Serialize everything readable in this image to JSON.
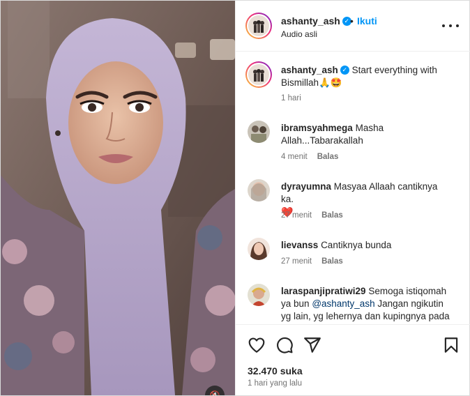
{
  "header": {
    "username": "ashanty_ash",
    "separator": "•",
    "follow_label": "Ikuti",
    "audio_label": "Audio asli",
    "verified_icon": "verified-badge-icon",
    "more_icon": "more-options-icon"
  },
  "caption": {
    "username": "ashanty_ash",
    "text": "Start everything with Bismillah",
    "emoji": "🙏🤩",
    "time": "1 hari"
  },
  "comments": [
    {
      "username": "ibramsyahmega",
      "text": "Masha Allah...Tabarakallah",
      "time": "4 menit",
      "reply_label": "Balas"
    },
    {
      "username": "dyrayumna",
      "text": "Masyaa Allaah cantiknya ka.",
      "emoji": "❤️",
      "time": "27 menit",
      "reply_label": "Balas"
    },
    {
      "username": "lievanss",
      "text": "Cantiknya bunda",
      "time": "27 menit",
      "reply_label": "Balas"
    },
    {
      "username": "laraspanjipratiwi29",
      "text_before": "Semoga istiqomah ya bun",
      "mention": "@ashanty_ash",
      "text_after": "Jangan ngikutin yg lain, yg lehernya dan kupingnya pada"
    }
  ],
  "actions": {
    "icons": [
      "heart-icon",
      "comment-icon",
      "share-icon",
      "bookmark-icon"
    ],
    "likes": "32.470 suka",
    "time_ago": "1 hari yang lalu"
  },
  "media": {
    "mute_icon": "mute-icon",
    "mute_glyph": "🔇"
  },
  "colors": {
    "accent": "#0095f6",
    "text": "#262626",
    "muted": "#737373",
    "border": "#efefef",
    "mention": "#00376b",
    "hijab": "#b7a8c9"
  }
}
